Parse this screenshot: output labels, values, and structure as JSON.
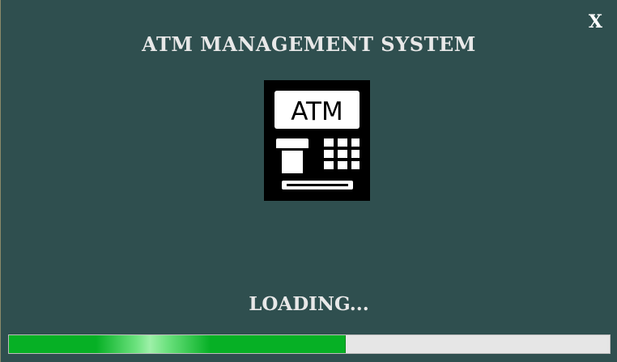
{
  "window": {
    "close_label": "X",
    "title": "ATM MANAGEMENT SYSTEM"
  },
  "logo": {
    "text": "ATM",
    "icon": "atm-machine-icon"
  },
  "status": {
    "loading_text": "LOADING..."
  },
  "progress": {
    "value": 0.56
  },
  "colors": {
    "background": "#2f4f4f",
    "progress_fill": "#06b025",
    "progress_track": "#e6e6e6",
    "text": "#e8e8e8"
  }
}
